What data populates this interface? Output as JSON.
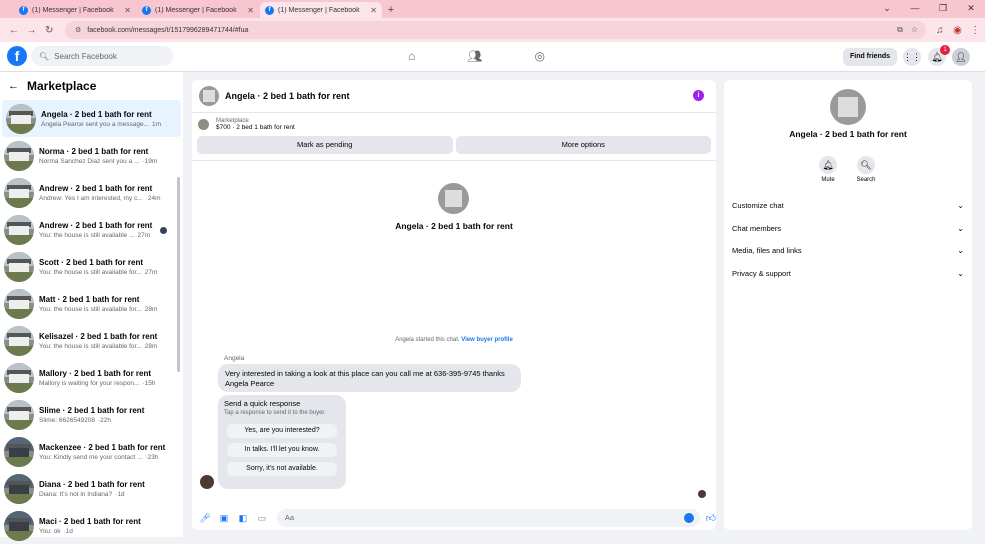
{
  "browser": {
    "tabs": [
      {
        "title": "(1) Messenger | Facebook"
      },
      {
        "title": "(1) Messenger | Facebook"
      },
      {
        "title": "(1) Messenger | Facebook"
      }
    ],
    "url": "facebook.com/messages/t/1517996289471744/#fua"
  },
  "facebook": {
    "search_placeholder": "Search Facebook",
    "find_friends": "Find friends",
    "notifications_count": "1"
  },
  "sidebar": {
    "title": "Marketplace",
    "items": [
      {
        "title": "Angela · 2 bed 1 bath for rent",
        "preview": "Angela Pearce sent you a message...",
        "ago": "1m"
      },
      {
        "title": "Norma · 2 bed 1 bath for rent",
        "preview": "Norma Sanchez Diaz sent you a ...",
        "ago": "·19m"
      },
      {
        "title": "Andrew · 2 bed 1 bath for rent",
        "preview": "Andrew: Yes I am interested, my c...",
        "ago": "·24m"
      },
      {
        "title": "Andrew · 2 bed 1 bath for rent",
        "preview": "You: the house is still available ...",
        "ago": "27m"
      },
      {
        "title": "Scott · 2 bed 1 bath for rent",
        "preview": "You: the house is still available for...",
        "ago": "27m"
      },
      {
        "title": "Matt · 2 bed 1 bath for rent",
        "preview": "You: the house is still available for...",
        "ago": "28m"
      },
      {
        "title": "Kelisazel · 2 bed 1 bath for rent",
        "preview": "You: the house is still available for...",
        "ago": "28m"
      },
      {
        "title": "Mallory · 2 bed 1 bath for rent",
        "preview": "Mallory is waiting for your respon...",
        "ago": "·15h"
      },
      {
        "title": "Slime · 2 bed 1 bath for rent",
        "preview": "Slime: 6626549208",
        "ago": "·22h"
      },
      {
        "title": "Mackenzee · 2 bed 1 bath for rent",
        "preview": "You: Kindly send me your contact ...",
        "ago": "·23h"
      },
      {
        "title": "Diana · 2 bed 1 bath for rent",
        "preview": "Diana: It's not in Indiana?",
        "ago": "·1d"
      },
      {
        "title": "Maci · 2 bed 1 bath for rent",
        "preview": "You: ok",
        "ago": "·1d"
      }
    ]
  },
  "chat": {
    "title": "Angela · 2 bed 1 bath for rent",
    "marketplace_label": "Marketplace",
    "listing": "$700 · 2 bed 1 bath for rent",
    "mark_pending": "Mark as pending",
    "more_options": "More options",
    "started": "Angela started this chat.",
    "view_profile": "View buyer profile",
    "sender": "Angela",
    "message": "Very interested in taking a look at this place can you call me at 636-395-9745 thanks Angela Pearce",
    "quick_title": "Send a quick response",
    "quick_sub": "Tap a response to send it to the buyer.",
    "quick_options": [
      "Yes, are you interested?",
      "In talks. I'll let you know.",
      "Sorry, it's not available."
    ],
    "input_placeholder": "Aa"
  },
  "details": {
    "name": "Angela · 2 bed 1 bath for rent",
    "mute": "Mute",
    "search": "Search",
    "rows": [
      "Customize chat",
      "Chat members",
      "Media, files and links",
      "Privacy & support"
    ]
  },
  "colors": {
    "brand": "#1877f2",
    "tabbar": "#f7c6d0",
    "badge": "#e41e3f"
  }
}
